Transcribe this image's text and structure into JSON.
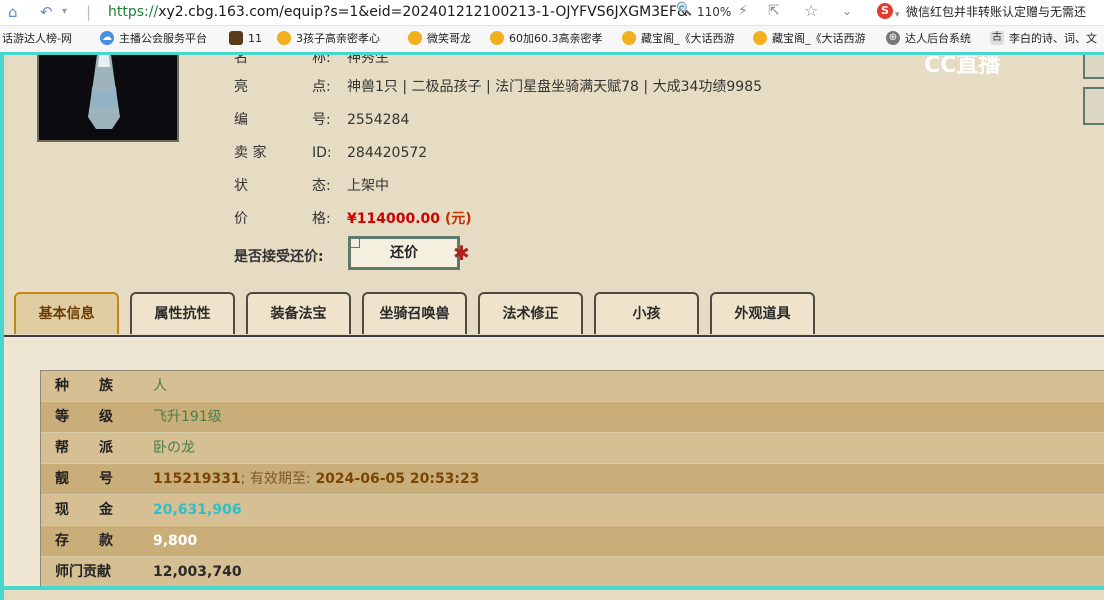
{
  "browser": {
    "url_scheme": "https://",
    "url_rest": "xy2.cbg.163.com/equip?s=1&eid=202401212100213-1-OJYFVS6JXGM3EF&",
    "zoom": "110%",
    "promo_text": "微信红包并非转账认定赠与无需还",
    "bookmarks": [
      "话游达人榜-网",
      "主播公会服务平台",
      "11",
      "3孩子高亲密孝心",
      "微笑哥龙",
      "60加60.3高亲密孝",
      "藏宝阁_《大话西游",
      "藏宝阁_《大话西游",
      "达人后台系统",
      "李白的诗、词、文"
    ]
  },
  "overlay": {
    "logo": "CC直播"
  },
  "item": {
    "name_label_a": "名",
    "name_label_b": "称:",
    "name_value": "神秀生",
    "highlight_label_a": "亮",
    "highlight_label_b": "点:",
    "highlight_value": "神兽1只 | 二极品孩子 | 法门星盘坐骑满天赋78 | 大成34功绩9985",
    "serial_label_a": "编",
    "serial_label_b": "号:",
    "serial_value": "2554284",
    "seller_label_a": "卖  家",
    "seller_label_b": "ID:",
    "seller_value": "284420572",
    "status_label_a": "状",
    "status_label_b": "态:",
    "status_value": "上架中",
    "price_label_a": "价",
    "price_label_b": "格:",
    "price_value": "¥114000.00",
    "price_unit": "(元)",
    "accept_label": "是否接受还价:",
    "offer_button": "还价"
  },
  "tabs": [
    "基本信息",
    "属性抗性",
    "装备法宝",
    "坐骑召唤兽",
    "法术修正",
    "小孩",
    "外观道具"
  ],
  "details": {
    "race_k1": "种",
    "race_k2": "族",
    "race_v": "人",
    "level_k1": "等",
    "level_k2": "级",
    "level_v": "飞升191级",
    "guild_k1": "帮",
    "guild_k2": "派",
    "guild_v": "卧の龙",
    "nice_k1": "靓",
    "nice_k2": "号",
    "nice_v": "115219331",
    "nice_sep": "; 有效期至:",
    "nice_expire": "2024-06-05 20:53:23",
    "cash_k1": "现",
    "cash_k2": "金",
    "cash_v": "20,631,906",
    "deposit_k1": "存",
    "deposit_k2": "款",
    "deposit_v": "9,800",
    "contrib_k": "师门贡献",
    "contrib_v": "12,003,740"
  }
}
